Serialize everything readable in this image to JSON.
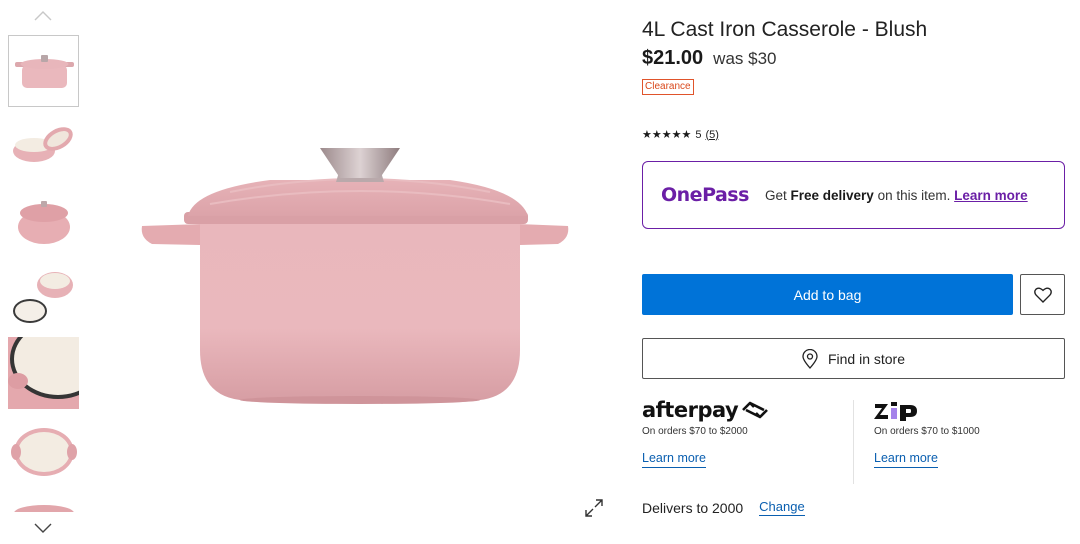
{
  "product": {
    "title": "4L Cast Iron Casserole - Blush",
    "price": "$21.00",
    "was_price": "was $30",
    "badge": "Clearance",
    "rating_value": "5",
    "review_count": "(5)",
    "stars": "★★★★★"
  },
  "onepass": {
    "logo": "OnePass",
    "text_prefix": "Get ",
    "text_bold": "Free delivery",
    "text_suffix": " on this item. ",
    "link": "Learn more"
  },
  "actions": {
    "add_to_bag": "Add to bag",
    "find_in_store": "Find in store"
  },
  "afterpay": {
    "logo": "afterpay",
    "note": "On orders $70 to $2000",
    "link": "Learn more"
  },
  "zip": {
    "logo": "zip",
    "note": "On orders $70 to $1000",
    "link": "Learn more"
  },
  "delivery": {
    "text": "Delivers to 2000",
    "change": "Change"
  },
  "colors": {
    "accent": "#0073d8",
    "onepass": "#6b1fa6",
    "clearance": "#d9491c",
    "product_pink": "#e7b1b6"
  },
  "icons": [
    "chevron-up-icon",
    "chevron-down-icon",
    "expand-icon",
    "heart-icon",
    "location-pin-icon"
  ]
}
